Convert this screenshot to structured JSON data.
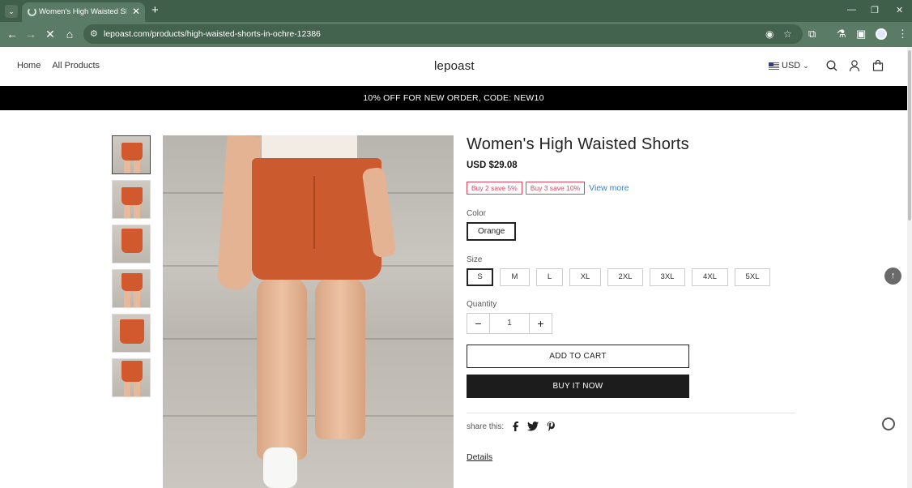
{
  "browser": {
    "tab_title": "Women's High Waisted Shorts",
    "url": "lepoast.com/products/high-waisted-shorts-in-ochre-12386"
  },
  "header": {
    "nav": [
      "Home",
      "All Products"
    ],
    "logo": "lepoast",
    "currency": "USD",
    "icons": [
      "search-icon",
      "account-icon",
      "cart-icon"
    ]
  },
  "announcement": "10% OFF FOR NEW ORDER, CODE: NEW10",
  "product": {
    "title": "Women's High Waisted Shorts",
    "price": "USD $29.08",
    "promotions": [
      "Buy 2 save 5%",
      "Buy 3 save 10%"
    ],
    "view_more": "View more",
    "color_label": "Color",
    "color_selected": "Orange",
    "size_label": "Size",
    "sizes": [
      "S",
      "M",
      "L",
      "XL",
      "2XL",
      "3XL",
      "4XL",
      "5XL"
    ],
    "size_selected": "S",
    "quantity_label": "Quantity",
    "quantity": "1",
    "add_to_cart": "ADD TO CART",
    "buy_now": "BUY IT NOW",
    "share_label": "share this:",
    "details_label": "Details"
  },
  "colors": {
    "promo_accent": "#e0455f",
    "link": "#3b82c4",
    "announcement_bg": "#000000",
    "browser_frame": "#3f5f4b",
    "product_color": "#cc5a2f"
  }
}
